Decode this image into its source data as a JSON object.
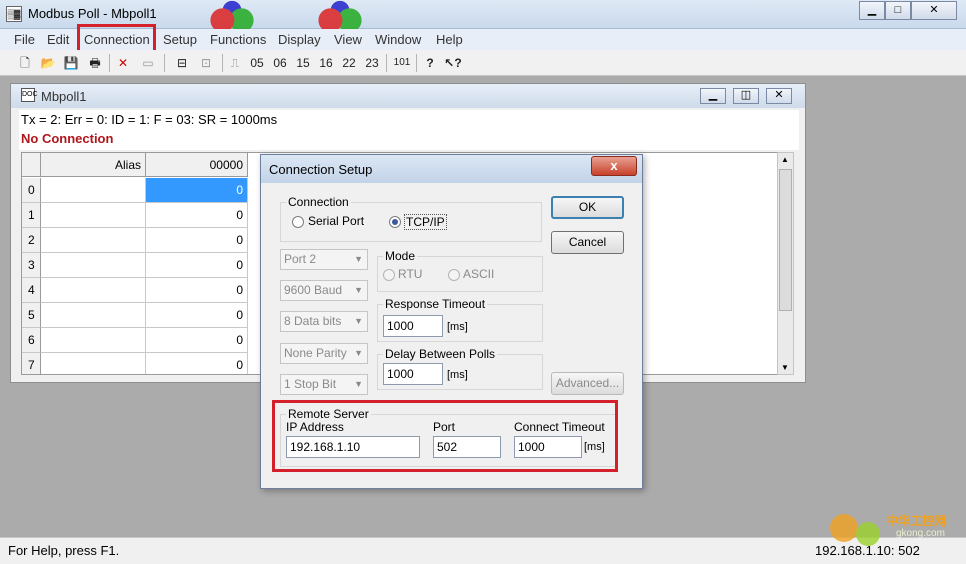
{
  "window": {
    "title": "Modbus Poll - Mbpoll1",
    "icon_text": "▒▓"
  },
  "menu": {
    "items": [
      "File",
      "Edit",
      "Connection",
      "Setup",
      "Functions",
      "Display",
      "View",
      "Window",
      "Help"
    ],
    "highlighted": "Connection"
  },
  "toolbar": {
    "function_codes": [
      "05",
      "06",
      "15",
      "16",
      "22",
      "23"
    ],
    "read_label": "101"
  },
  "child": {
    "title": "Mbpoll1",
    "status_line": "Tx = 2: Err = 0: ID = 1: F = 03: SR = 1000ms",
    "connection_status": "No Connection",
    "status_color": "#b0161c",
    "grid": {
      "columns": [
        "Alias",
        "00000"
      ],
      "rows": [
        {
          "index": "0",
          "value": "0",
          "selected": true
        },
        {
          "index": "1",
          "value": "0"
        },
        {
          "index": "2",
          "value": "0"
        },
        {
          "index": "3",
          "value": "0"
        },
        {
          "index": "4",
          "value": "0"
        },
        {
          "index": "5",
          "value": "0"
        },
        {
          "index": "6",
          "value": "0"
        },
        {
          "index": "7",
          "value": "0"
        }
      ]
    }
  },
  "dialog": {
    "title": "Connection Setup",
    "close": "x",
    "connection_group": "Connection",
    "serial_port": "Serial Port",
    "tcp_ip": "TCP/IP",
    "selected_connection": "TCP/IP",
    "port_combo": "Port 2",
    "baud_combo": "9600 Baud",
    "data_bits_combo": "8 Data bits",
    "parity_combo": "None Parity",
    "stop_bit_combo": "1 Stop Bit",
    "mode_group": "Mode",
    "rtu": "RTU",
    "ascii": "ASCII",
    "response_timeout_label": "Response Timeout",
    "response_timeout": "1000",
    "response_unit": "[ms]",
    "delay_label": "Delay Between Polls",
    "delay": "1000",
    "delay_unit": "[ms]",
    "ok": "OK",
    "cancel": "Cancel",
    "advanced": "Advanced...",
    "remote_group": "Remote Server",
    "ip_label": "IP Address",
    "ip": "192.168.1.10",
    "port_label": "Port",
    "port": "502",
    "connect_timeout_label": "Connect Timeout",
    "connect_timeout": "1000",
    "connect_timeout_unit": "[ms]"
  },
  "statusbar": {
    "help": "For Help, press F1.",
    "remote": "192.168.1.10: 502"
  },
  "watermark": {
    "text": "中华工控网",
    "url": "gkong.com"
  },
  "colors": {
    "highlight_border": "#d4202a",
    "selection": "#3399ff"
  }
}
